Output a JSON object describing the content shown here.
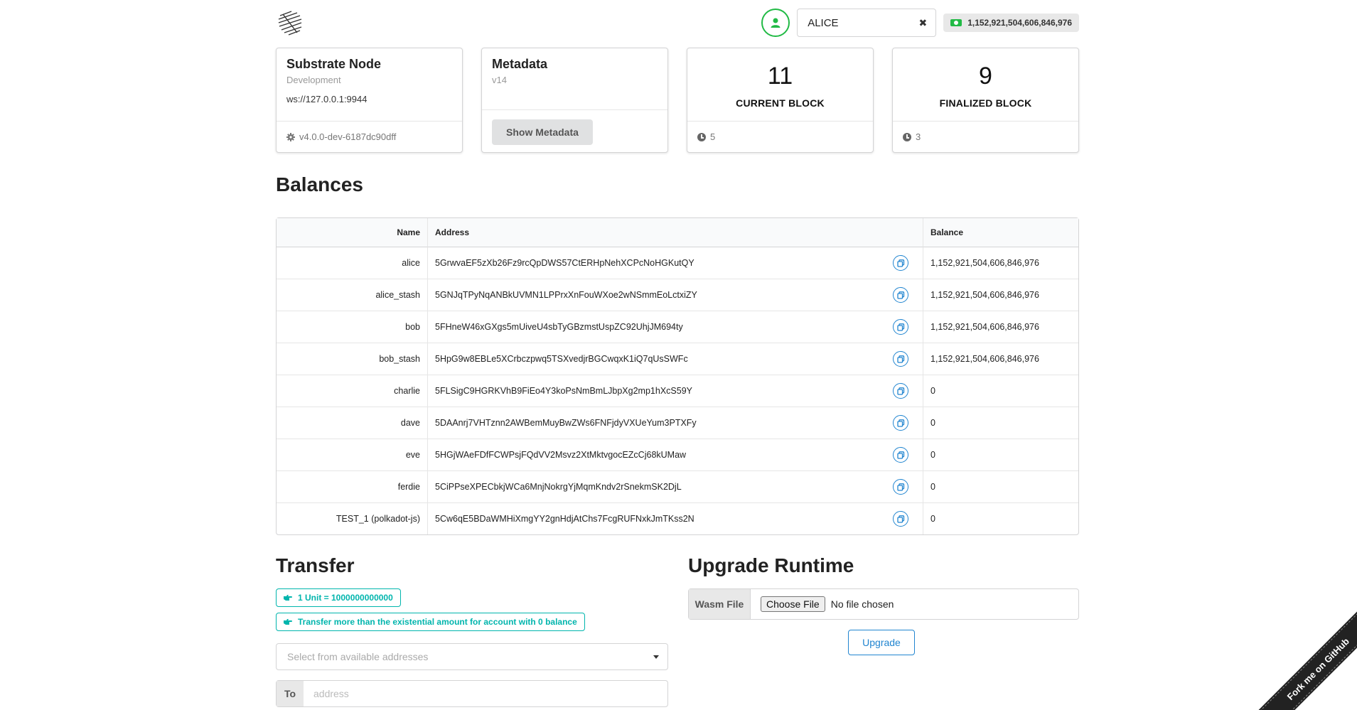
{
  "header": {
    "account_name": "ALICE",
    "account_balance": "1,152,921,504,606,846,976"
  },
  "cards": {
    "node": {
      "title": "Substrate Node",
      "meta": "Development",
      "endpoint": "ws://127.0.0.1:9944",
      "version": "v4.0.0-dev-6187dc90dff"
    },
    "metadata": {
      "title": "Metadata",
      "version": "v14",
      "button_label": "Show Metadata"
    },
    "current_block": {
      "number": "11",
      "label": "CURRENT BLOCK",
      "timer": "5"
    },
    "finalized_block": {
      "number": "9",
      "label": "FINALIZED BLOCK",
      "timer": "3"
    }
  },
  "balances": {
    "title": "Balances",
    "headers": [
      "Name",
      "Address",
      "Balance"
    ],
    "rows": [
      {
        "name": "alice",
        "address": "5GrwvaEF5zXb26Fz9rcQpDWS57CtERHpNehXCPcNoHGKutQY",
        "balance": "1,152,921,504,606,846,976"
      },
      {
        "name": "alice_stash",
        "address": "5GNJqTPyNqANBkUVMN1LPPrxXnFouWXoe2wNSmmEoLctxiZY",
        "balance": "1,152,921,504,606,846,976"
      },
      {
        "name": "bob",
        "address": "5FHneW46xGXgs5mUiveU4sbTyGBzmstUspZC92UhjJM694ty",
        "balance": "1,152,921,504,606,846,976"
      },
      {
        "name": "bob_stash",
        "address": "5HpG9w8EBLe5XCrbczpwq5TSXvedjrBGCwqxK1iQ7qUsSWFc",
        "balance": "1,152,921,504,606,846,976"
      },
      {
        "name": "charlie",
        "address": "5FLSigC9HGRKVhB9FiEo4Y3koPsNmBmLJbpXg2mp1hXcS59Y",
        "balance": "0"
      },
      {
        "name": "dave",
        "address": "5DAAnrj7VHTznn2AWBemMuyBwZWs6FNFjdyVXUeYum3PTXFy",
        "balance": "0"
      },
      {
        "name": "eve",
        "address": "5HGjWAeFDfFCWPsjFQdVV2Msvz2XtMktvgocEZcCj68kUMaw",
        "balance": "0"
      },
      {
        "name": "ferdie",
        "address": "5CiPPseXPECbkjWCa6MnjNokrgYjMqmKndv2rSnekmSK2DjL",
        "balance": "0"
      },
      {
        "name": "TEST_1 (polkadot-js)",
        "address": "5Cw6qE5BDaWMHiXmgYY2gnHdjAtChs7FcgRUFNxkJmTKss2N",
        "balance": "0"
      }
    ]
  },
  "transfer": {
    "title": "Transfer",
    "info_unit": "1 Unit = 1000000000000",
    "info_existential": "Transfer more than the existential amount for account with 0 balance",
    "from_placeholder": "Select from available addresses",
    "to_label": "To",
    "to_placeholder": "address"
  },
  "upgrade": {
    "title": "Upgrade Runtime",
    "file_label": "Wasm File",
    "choose_button": "Choose File",
    "file_status": "No file chosen",
    "button_label": "Upgrade"
  },
  "ribbon": {
    "label": "Fork me on GitHub"
  },
  "colors": {
    "accent_green": "#21ba45",
    "accent_teal": "#00b5ad",
    "accent_blue": "#2185d0"
  }
}
